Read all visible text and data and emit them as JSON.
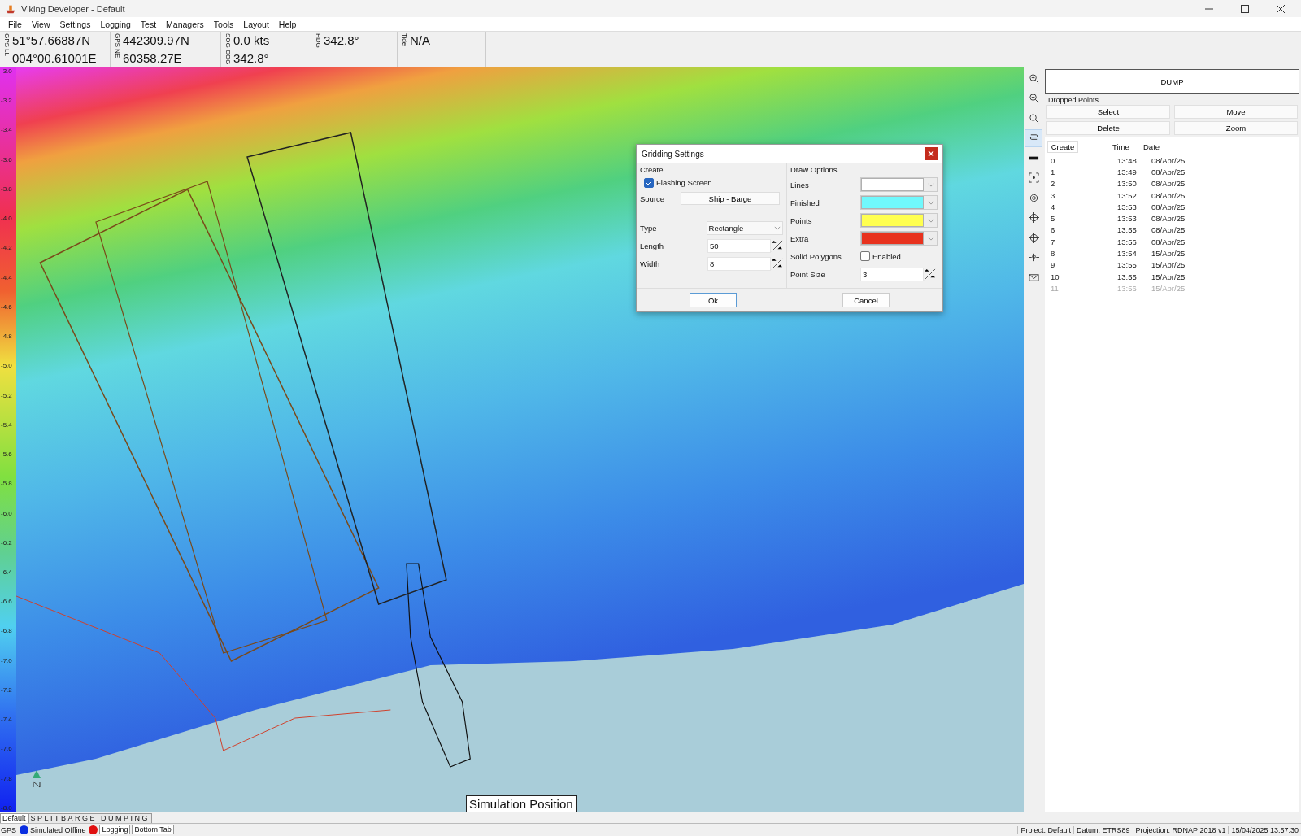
{
  "window": {
    "title": "Viking Developer - Default"
  },
  "menu": [
    "File",
    "View",
    "Settings",
    "Logging",
    "Test",
    "Managers",
    "Tools",
    "Layout",
    "Help"
  ],
  "info_bar": [
    {
      "label": "GPS LL",
      "values": [
        "51°57.66887N",
        "004°00.61001E"
      ]
    },
    {
      "label": "GPS NE",
      "values": [
        "442309.97N",
        "60358.27E"
      ]
    },
    {
      "label": "SOG COG",
      "values": [
        "0.0 kts",
        "342.8°"
      ]
    },
    {
      "label": "HDG",
      "values": [
        "342.8°"
      ]
    },
    {
      "label": "Tide",
      "values": [
        "N/A"
      ]
    }
  ],
  "depth_scale": [
    "-3.0",
    "-3.2",
    "-3.4",
    "-3.6",
    "-3.8",
    "-4.0",
    "-4.2",
    "-4.4",
    "-4.6",
    "-4.8",
    "-5.0",
    "-5.2",
    "-5.4",
    "-5.6",
    "-5.8",
    "-6.0",
    "-6.2",
    "-6.4",
    "-6.6",
    "-6.8",
    "-7.0",
    "-7.2",
    "-7.4",
    "-7.6",
    "-7.8",
    "-8.0"
  ],
  "map": {
    "position_label": "Simulation Position"
  },
  "dialog": {
    "title": "Gridding Settings",
    "create": {
      "heading": "Create",
      "flashing": {
        "label": "Flashing Screen",
        "checked": true
      },
      "source_label": "Source",
      "source_button": "Ship - Barge",
      "fields": [
        {
          "kind": "select",
          "label": "Type",
          "value": "Rectangle"
        },
        {
          "kind": "spin",
          "label": "Length",
          "value": "50"
        },
        {
          "kind": "spin",
          "label": "Width",
          "value": "8"
        }
      ]
    },
    "draw": {
      "heading": "Draw Options",
      "colors": [
        {
          "label": "Lines",
          "color": "#ffffff"
        },
        {
          "label": "Finished",
          "color": "#70f8fc"
        },
        {
          "label": "Points",
          "color": "#ffff50"
        },
        {
          "label": "Extra",
          "color": "#e8321e"
        }
      ],
      "solid": {
        "label": "Solid Polygons",
        "option": "Enabled",
        "checked": false
      },
      "point_size": {
        "label": "Point Size",
        "value": "3"
      }
    },
    "buttons": [
      "Ok",
      "Cancel"
    ]
  },
  "tools": [
    {
      "kind": "zoom-in",
      "selected": false
    },
    {
      "kind": "zoom-out",
      "selected": false
    },
    {
      "kind": "zoom-fit",
      "selected": false
    },
    {
      "kind": "route",
      "selected": true
    },
    {
      "kind": "ruler",
      "selected": false
    },
    {
      "kind": "frame",
      "selected": false
    },
    {
      "kind": "target",
      "selected": false
    },
    {
      "kind": "crosshair",
      "selected": false
    },
    {
      "kind": "crosshair",
      "selected": false
    },
    {
      "kind": "point",
      "selected": false
    },
    {
      "kind": "mail",
      "selected": false
    }
  ],
  "panel": {
    "dump_button": "DUMP",
    "group_title": "Dropped Points",
    "buttons": [
      "Select",
      "Move",
      "Delete",
      "Zoom"
    ],
    "columns": [
      "Create",
      "Time",
      "Date"
    ],
    "rows": [
      {
        "id": "0",
        "time": "13:48",
        "date": "08/Apr/25",
        "disabled": false
      },
      {
        "id": "1",
        "time": "13:49",
        "date": "08/Apr/25",
        "disabled": false
      },
      {
        "id": "2",
        "time": "13:50",
        "date": "08/Apr/25",
        "disabled": false
      },
      {
        "id": "3",
        "time": "13:52",
        "date": "08/Apr/25",
        "disabled": false
      },
      {
        "id": "4",
        "time": "13:53",
        "date": "08/Apr/25",
        "disabled": false
      },
      {
        "id": "5",
        "time": "13:53",
        "date": "08/Apr/25",
        "disabled": false
      },
      {
        "id": "6",
        "time": "13:55",
        "date": "08/Apr/25",
        "disabled": false
      },
      {
        "id": "7",
        "time": "13:56",
        "date": "08/Apr/25",
        "disabled": false
      },
      {
        "id": "8",
        "time": "13:54",
        "date": "15/Apr/25",
        "disabled": false
      },
      {
        "id": "9",
        "time": "13:55",
        "date": "15/Apr/25",
        "disabled": false
      },
      {
        "id": "10",
        "time": "13:55",
        "date": "15/Apr/25",
        "disabled": false
      },
      {
        "id": "11",
        "time": "13:56",
        "date": "15/Apr/25",
        "disabled": true
      }
    ]
  },
  "view_tabs": [
    {
      "label": "Default",
      "selected": true
    },
    {
      "label": "SPLITBARGE  DUMPING",
      "selected": false
    }
  ],
  "status_bar": {
    "gps_label": "GPS",
    "indicators": [
      {
        "label": "Simulated Offline",
        "color": "#0a2ee0"
      },
      {
        "color": "#e01010"
      }
    ],
    "tabs": [
      "Logging",
      "Bottom Tab"
    ],
    "right": [
      "Project: Default",
      "Datum: ETRS89",
      "Projection: RDNAP 2018 v1",
      "15/04/2025 13:57:30"
    ]
  }
}
